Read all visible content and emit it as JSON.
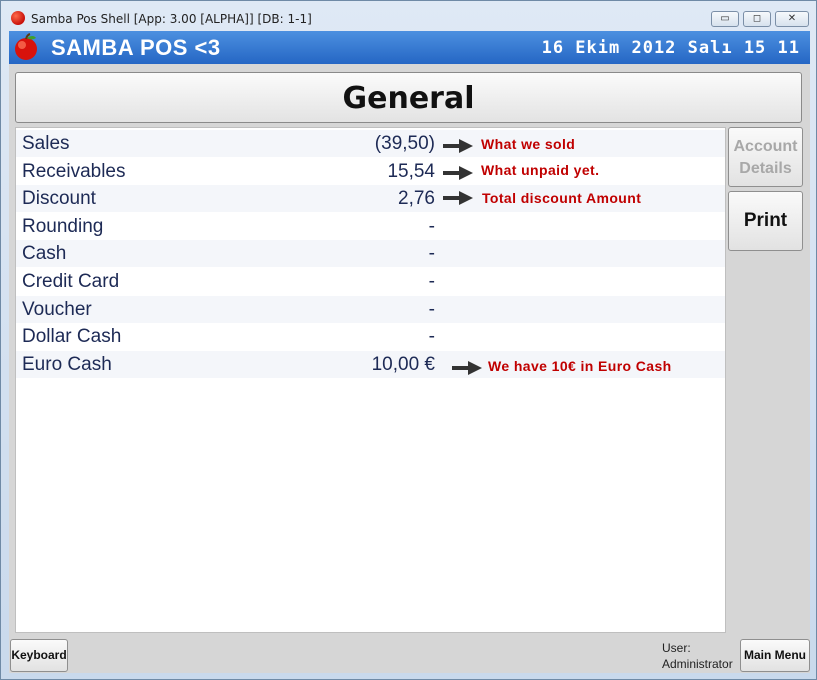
{
  "window": {
    "title": "Samba Pos Shell [App: 3.00 [ALPHA]] [DB: 1-1]",
    "controls": {
      "minimize": "▭",
      "maximize": "◻",
      "close": "✕"
    }
  },
  "header": {
    "brand": "SAMBA POS <3",
    "datetime": "16 Ekim 2012 Salı 15 11",
    "logo_icon": "apple-icon",
    "background": "#2f73cf"
  },
  "section": {
    "title": "General"
  },
  "report": {
    "rows": [
      {
        "label": "Sales",
        "value": "(39,50)"
      },
      {
        "label": "Receivables",
        "value": "15,54"
      },
      {
        "label": "Discount",
        "value": "2,76"
      },
      {
        "label": "Rounding",
        "value": "-"
      },
      {
        "label": "Cash",
        "value": "-"
      },
      {
        "label": "Credit Card",
        "value": "-"
      },
      {
        "label": "Voucher",
        "value": "-"
      },
      {
        "label": "Dollar Cash",
        "value": "-"
      },
      {
        "label": "Euro Cash",
        "value": "10,00 €"
      }
    ],
    "annotations": [
      "What we sold",
      "What unpaid yet.",
      "Total discount Amount",
      "We have 10€ in Euro Cash"
    ],
    "annotation_color": "#c00000"
  },
  "side": {
    "account_details": "Account Details",
    "print": "Print"
  },
  "footer": {
    "keyboard": "Keyboard",
    "user_label": "User:",
    "user_name": "Administrator",
    "main_menu": "Main Menu"
  }
}
